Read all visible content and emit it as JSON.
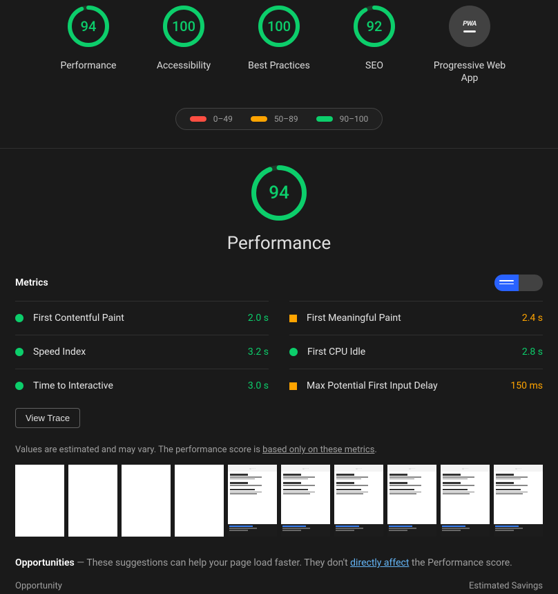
{
  "gauges": [
    {
      "score": "94",
      "label": "Performance",
      "pct": 0.94,
      "color": "#0cce6b"
    },
    {
      "score": "100",
      "label": "Accessibility",
      "pct": 1.0,
      "color": "#0cce6b"
    },
    {
      "score": "100",
      "label": "Best Practices",
      "pct": 1.0,
      "color": "#0cce6b"
    },
    {
      "score": "92",
      "label": "SEO",
      "pct": 0.92,
      "color": "#0cce6b"
    }
  ],
  "pwa_label": "Progressive Web App",
  "pwa_text": "PWA",
  "legend": {
    "fail": {
      "range": "0–49",
      "color": "#ff4e42"
    },
    "average": {
      "range": "50–89",
      "color": "#ffa400"
    },
    "pass": {
      "range": "90–100",
      "color": "#0cce6b"
    }
  },
  "perf_section": {
    "score": "94",
    "pct": 0.94,
    "title": "Performance"
  },
  "metrics_label": "Metrics",
  "metrics": {
    "left": [
      {
        "name": "First Contentful Paint",
        "value": "2.0 s",
        "status": "pass"
      },
      {
        "name": "Speed Index",
        "value": "3.2 s",
        "status": "pass"
      },
      {
        "name": "Time to Interactive",
        "value": "3.0 s",
        "status": "pass"
      }
    ],
    "right": [
      {
        "name": "First Meaningful Paint",
        "value": "2.4 s",
        "status": "average"
      },
      {
        "name": "First CPU Idle",
        "value": "2.8 s",
        "status": "pass"
      },
      {
        "name": "Max Potential First Input Delay",
        "value": "150 ms",
        "status": "average"
      }
    ]
  },
  "view_trace": "View Trace",
  "disclaimer_pre": "Values are estimated and may vary. The performance score is ",
  "disclaimer_link": "based only on these metrics",
  "disclaimer_post": ".",
  "filmstrip": [
    {
      "type": "blank"
    },
    {
      "type": "blank"
    },
    {
      "type": "blank"
    },
    {
      "type": "blank"
    },
    {
      "type": "content"
    },
    {
      "type": "content"
    },
    {
      "type": "content"
    },
    {
      "type": "content"
    },
    {
      "type": "content"
    },
    {
      "type": "content"
    }
  ],
  "opportunities": {
    "heading": "Opportunities",
    "desc_pre": "  —  These suggestions can help your page load faster. They don't ",
    "desc_link": "directly affect",
    "desc_post": " the Performance score.",
    "col_left": "Opportunity",
    "col_right": "Estimated Savings"
  }
}
